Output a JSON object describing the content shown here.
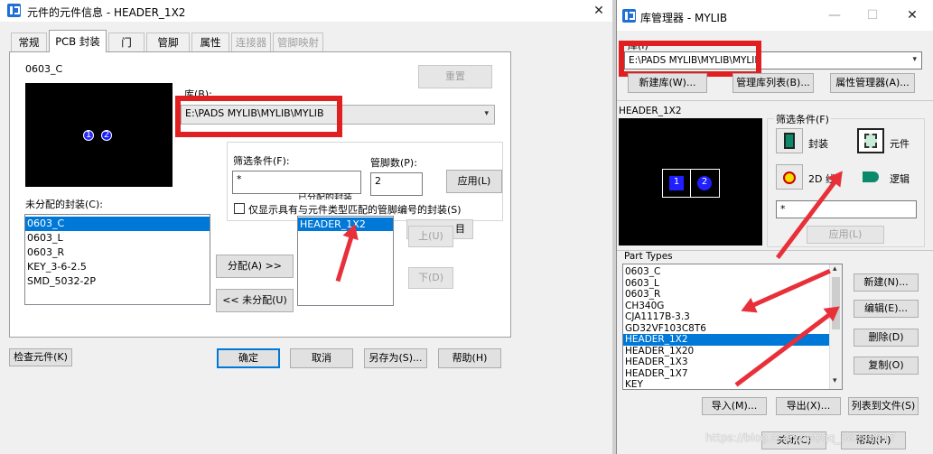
{
  "left_dialog": {
    "title": "元件的元件信息 - HEADER_1X2",
    "close_glyph": "✕",
    "tabs": [
      {
        "label": "常规"
      },
      {
        "label": "PCB 封装"
      },
      {
        "label": "门"
      },
      {
        "label": "管脚"
      },
      {
        "label": "属性"
      },
      {
        "label": "连接器"
      },
      {
        "label": "管脚映射"
      }
    ],
    "footprint_name": "0603_C",
    "preview_pads": [
      "1",
      "2"
    ],
    "library_label": "库(B):",
    "library_value": "E:\\PADS MYLIB\\MYLIB\\MYLIB",
    "reset_button": "重置",
    "filter_label": "筛选条件(F):",
    "filter_value": "*",
    "pin_count_label": "管脚数(P):",
    "pin_count_value": "2",
    "apply_button": "应用(L)",
    "obscured_label": "已分配的封装",
    "match_checkbox_label": "仅显示具有与元件类型匹配的管脚编号的封装(S)",
    "unassigned_label": "未分配的封装(C):",
    "unassigned_items": [
      "0603_C",
      "0603_L",
      "0603_R",
      "KEY_3-6-2.5",
      "SMD_5032-2P"
    ],
    "assigned_items": [
      "HEADER_1X2"
    ],
    "obscured_button": "目",
    "assign_button": "分配(A) >>",
    "unassign_button": "<< 未分配(U)",
    "up_button": "上(U)",
    "down_button": "下(D)",
    "check_part_button": "检查元件(K)",
    "ok_button": "确定",
    "cancel_button": "取消",
    "save_as_button": "另存为(S)...",
    "help_button": "帮助(H)"
  },
  "right_dialog": {
    "title": "库管理器 - MYLIB",
    "minimize_glyph": "—",
    "maximize_glyph": "☐",
    "close_glyph": "✕",
    "library_label": "库(I)",
    "library_value": "E:\\PADS MYLIB\\MYLIB\\MYLIB",
    "new_lib_button": "新建库(W)...",
    "manage_list_button": "管理库列表(B)...",
    "attr_manager_button": "属性管理器(A)...",
    "preview_name": "HEADER_1X2",
    "preview_pads": [
      "1",
      "2"
    ],
    "filter_group_label": "筛选条件(F)",
    "filter_types": [
      {
        "label": "封装",
        "icon": "decal-icon"
      },
      {
        "label": "元件",
        "icon": "part-icon"
      },
      {
        "label": "2D 线",
        "icon": "2d-line-icon"
      },
      {
        "label": "逻辑",
        "icon": "logic-icon"
      }
    ],
    "filter_value": "*",
    "apply_button": "应用(L)",
    "part_types_label": "Part Types",
    "part_types": [
      "0603_C",
      "0603_L",
      "0603_R",
      "CH340G",
      "CJA1117B-3.3",
      "GD32VF103C8T6",
      "HEADER_1X2",
      "HEADER_1X20",
      "HEADER_1X3",
      "HEADER_1X7",
      "KEY"
    ],
    "selected_part": "HEADER_1X2",
    "new_button": "新建(N)...",
    "edit_button": "编辑(E)...",
    "delete_button": "删除(D)",
    "copy_button": "复制(O)",
    "import_button": "导入(M)...",
    "export_button": "导出(X)...",
    "list_to_file_button": "列表到文件(S)",
    "close_button": "关闭(C)",
    "help_button": "帮助(H)",
    "watermark": "https://blog.csdn.net/qq_38388817"
  },
  "colors": {
    "highlight_red": "#e02020",
    "selection_blue": "#0078d7",
    "pad_blue": "#1a1aff"
  }
}
